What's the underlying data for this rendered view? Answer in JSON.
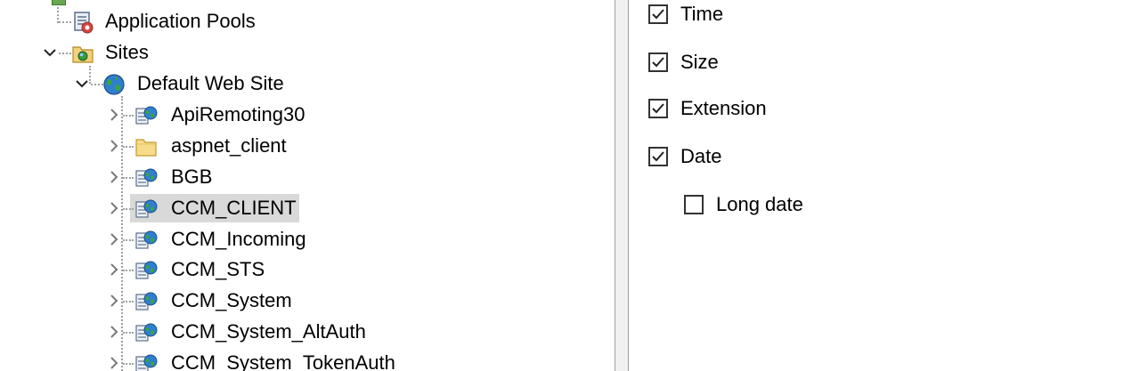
{
  "tree": {
    "items": [
      {
        "label": "Application Pools",
        "icon": "app-pool-icon"
      },
      {
        "label": "Sites",
        "icon": "sites-folder-icon"
      },
      {
        "label": "Default Web Site",
        "icon": "globe-icon"
      },
      {
        "label": "ApiRemoting30",
        "icon": "web-app-icon"
      },
      {
        "label": "aspnet_client",
        "icon": "folder-icon"
      },
      {
        "label": "BGB",
        "icon": "web-app-icon"
      },
      {
        "label": "CCM_CLIENT",
        "icon": "web-app-icon",
        "selected": true
      },
      {
        "label": "CCM_Incoming",
        "icon": "web-app-icon"
      },
      {
        "label": "CCM_STS",
        "icon": "web-app-icon"
      },
      {
        "label": "CCM_System",
        "icon": "web-app-icon"
      },
      {
        "label": "CCM_System_AltAuth",
        "icon": "web-app-icon"
      },
      {
        "label": "CCM_System_TokenAuth",
        "icon": "web-app-icon"
      }
    ]
  },
  "options": {
    "time": {
      "label": "Time",
      "checked": true
    },
    "size": {
      "label": "Size",
      "checked": true
    },
    "extension": {
      "label": "Extension",
      "checked": true
    },
    "date": {
      "label": "Date",
      "checked": true
    },
    "long_date": {
      "label": "Long date",
      "checked": false
    }
  },
  "colors": {
    "selection": "#d9d9d9",
    "tree_lines": "#a0a0a0",
    "splitter": "#f0f0f0"
  }
}
